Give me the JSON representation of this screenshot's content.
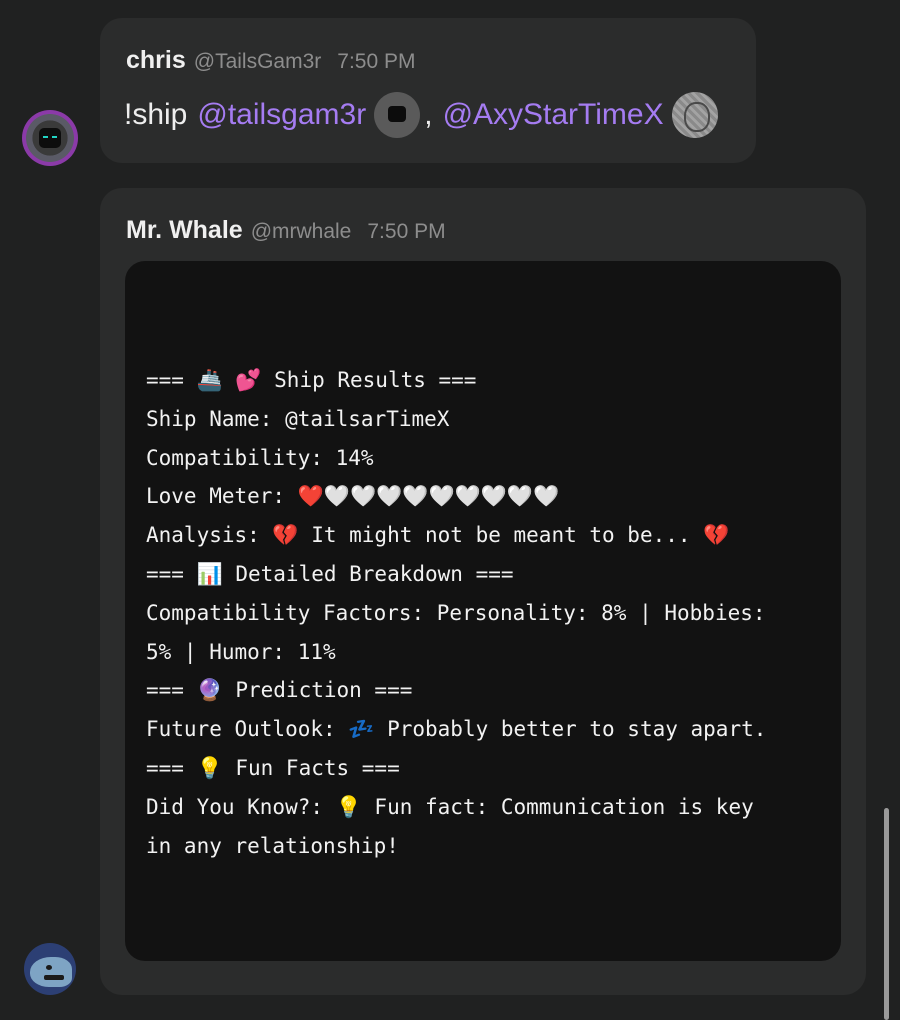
{
  "messages": [
    {
      "author": "chris",
      "handle": "@TailsGam3r",
      "time": "7:50 PM",
      "command": "!ship",
      "mention_1": "@tailsgam3r",
      "separator": ",",
      "mention_2": "@AxyStarTimeX"
    },
    {
      "author": "Mr. Whale",
      "handle": "@mrwhale",
      "time": "7:50 PM",
      "code_lines": [
        "=== 🚢 💕 Ship Results ===",
        "Ship Name: @tailsarTimeX",
        "Compatibility: 14%",
        "Love Meter: ❤️🤍🤍🤍🤍🤍🤍🤍🤍🤍",
        "Analysis: 💔 It might not be meant to be... 💔",
        "=== 📊 Detailed Breakdown ===",
        "Compatibility Factors: Personality: 8% | Hobbies:",
        "5% | Humor: 11%",
        "=== 🔮 Prediction ===",
        "Future Outlook: 💤 Probably better to stay apart.",
        "=== 💡 Fun Facts ===",
        "Did You Know?: 💡 Fun fact: Communication is key",
        "in any relationship!"
      ]
    }
  ],
  "icons": {
    "chris_avatar": "avatar-chris",
    "whale_avatar": "avatar-mrwhale",
    "tails_mention_avatar": "avatar-tailsgam3r",
    "axy_mention_avatar": "avatar-axystartimex"
  },
  "colors": {
    "background": "#202121",
    "bubble": "#2b2c2c",
    "code_block": "#121212",
    "mention": "#a57cf2",
    "muted_text": "#8d8d8d"
  }
}
